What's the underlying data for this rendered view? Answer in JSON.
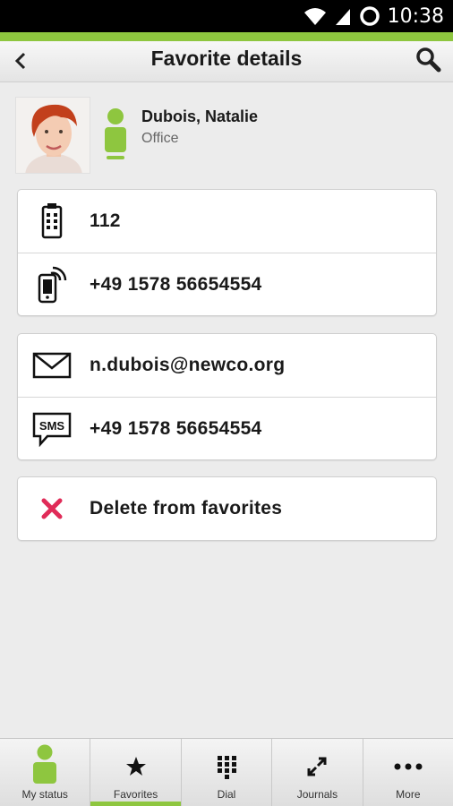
{
  "status_bar": {
    "time": "10:38"
  },
  "header": {
    "title": "Favorite details"
  },
  "contact": {
    "name": "Dubois, Natalie",
    "subtitle": "Office"
  },
  "phone_card": [
    {
      "icon": "office-phone-icon",
      "value": "112"
    },
    {
      "icon": "mobile-phone-icon",
      "value": "+49 1578 56654554"
    }
  ],
  "message_card": [
    {
      "icon": "email-icon",
      "value": "n.dubois@newco.org"
    },
    {
      "icon": "sms-icon",
      "value": "+49 1578 56654554"
    }
  ],
  "actions": {
    "delete_label": "Delete from favorites"
  },
  "bottom_nav": [
    {
      "label": "My status",
      "icon": "presence-person-icon",
      "active": false
    },
    {
      "label": "Favorites",
      "icon": "star-icon",
      "active": true
    },
    {
      "label": "Dial",
      "icon": "dialpad-icon",
      "active": false
    },
    {
      "label": "Journals",
      "icon": "call-journal-icon",
      "active": false
    },
    {
      "label": "More",
      "icon": "more-dots-icon",
      "active": false
    }
  ],
  "colors": {
    "accent": "#8ec63f",
    "delete": "#e02b58",
    "background": "#ececec"
  }
}
